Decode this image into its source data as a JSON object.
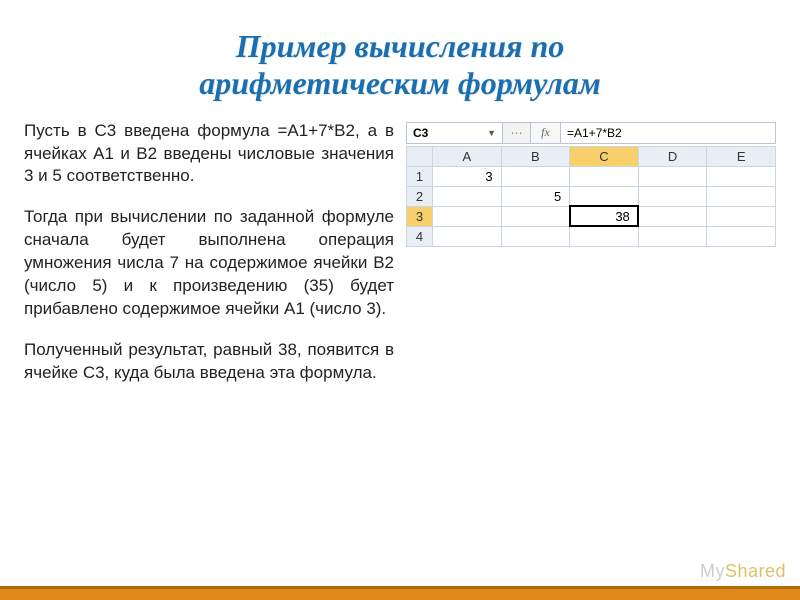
{
  "title_line1": "Пример вычисления по",
  "title_line2": "арифметическим формулам",
  "paragraphs": {
    "p1": "Пусть в C3 введена формула =A1+7*B2, а в ячейках A1 и B2 введены числовые значения 3 и 5 соответственно.",
    "p2": "Тогда при вычислении по заданной формуле сначала будет выполнена операция умножения числа 7 на содержимое ячейки B2 (число 5) и к произведению (35) будет прибавлено содержимое ячейки A1 (число 3).",
    "p3": "Полученный результат, равный 38, появится в ячейке C3, куда была введена эта формула."
  },
  "spreadsheet": {
    "active_cell": "C3",
    "fx_label": "fx",
    "formula": "=A1+7*B2",
    "columns": [
      "A",
      "B",
      "C",
      "D",
      "E"
    ],
    "rows": [
      "1",
      "2",
      "3",
      "4"
    ],
    "cells": {
      "A1": "3",
      "B2": "5",
      "C3": "38"
    }
  },
  "watermark": {
    "part1": "My",
    "part2": "Shared"
  }
}
